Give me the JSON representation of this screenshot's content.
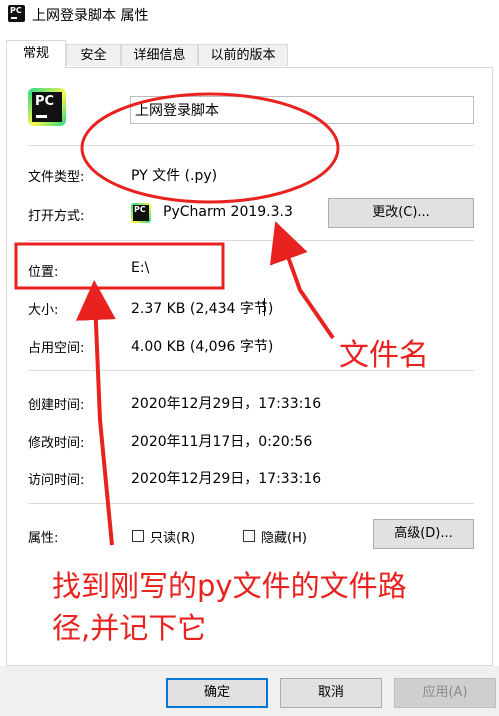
{
  "window": {
    "title": "上网登录脚本 属性",
    "app_icon_text": "PC"
  },
  "tabs": [
    {
      "label": "常规",
      "active": true
    },
    {
      "label": "安全",
      "active": false
    },
    {
      "label": "详细信息",
      "active": false
    },
    {
      "label": "以前的版本",
      "active": false
    }
  ],
  "general": {
    "file_name": "上网登录脚本",
    "file_type_label": "文件类型:",
    "file_type_value": "PY 文件 (.py)",
    "open_with_label": "打开方式:",
    "open_with_value": "PyCharm 2019.3.3",
    "change_button": "更改(C)...",
    "location_label": "位置:",
    "location_value": "E:\\",
    "size_label": "大小:",
    "size_value": "2.37 KB (2,434 字节)",
    "size_on_disk_label": "占用空间:",
    "size_on_disk_value": "4.00 KB (4,096 字节)",
    "created_label": "创建时间:",
    "created_value": "2020年12月29日，17:33:16",
    "modified_label": "修改时间:",
    "modified_value": "2020年11月17日，0:20:56",
    "accessed_label": "访问时间:",
    "accessed_value": "2020年12月29日，17:33:16",
    "attributes_label": "属性:",
    "readonly_label": "只读(R)",
    "readonly_checked": false,
    "hidden_label": "隐藏(H)",
    "hidden_checked": false,
    "advanced_button": "高级(D)..."
  },
  "footer": {
    "ok": "确定",
    "cancel": "取消",
    "apply": "应用(A)"
  },
  "annotations": {
    "filename_note": "文件名",
    "path_note_line1": "找到刚写的py文件的文件路",
    "path_note_line2": "径,并记下它"
  },
  "colors": {
    "annotation_red": "#e8231f",
    "accent_blue": "#0078d7"
  }
}
